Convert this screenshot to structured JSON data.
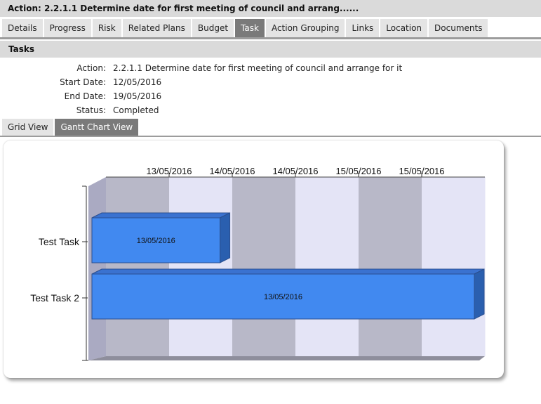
{
  "header": {
    "title": "Action: 2.2.1.1 Determine date for first meeting of council and arrang......"
  },
  "tabs": [
    {
      "label": "Details",
      "active": false
    },
    {
      "label": "Progress",
      "active": false
    },
    {
      "label": "Risk",
      "active": false
    },
    {
      "label": "Related Plans",
      "active": false
    },
    {
      "label": "Budget",
      "active": false
    },
    {
      "label": "Task",
      "active": true
    },
    {
      "label": "Action Grouping",
      "active": false
    },
    {
      "label": "Links",
      "active": false
    },
    {
      "label": "Location",
      "active": false
    },
    {
      "label": "Documents",
      "active": false
    }
  ],
  "section": {
    "title": "Tasks"
  },
  "info": {
    "action_label": "Action:",
    "action_value": "2.2.1.1 Determine date for first meeting of council and arrange for it",
    "start_label": "Start Date:",
    "start_value": "12/05/2016",
    "end_label": "End Date:",
    "end_value": "19/05/2016",
    "status_label": "Status:",
    "status_value": "Completed"
  },
  "view_tabs": [
    {
      "label": "Grid View",
      "active": false
    },
    {
      "label": "Gantt Chart View",
      "active": true
    }
  ],
  "colors": {
    "bar_front": "#4189f0",
    "bar_top": "#3a72d0",
    "bar_side": "#2a5faf",
    "band_dark": "#b8b8c8",
    "band_light": "#e4e4f6",
    "wall": "#aaaac2"
  },
  "chart_data": {
    "type": "gantt",
    "x_tick_labels": [
      "13/05/2016",
      "14/05/2016",
      "14/05/2016",
      "15/05/2016",
      "15/05/2016"
    ],
    "tasks": [
      {
        "name": "Test Task",
        "bar_label": "13/05/2016",
        "start_fraction": 0.0,
        "end_fraction": 0.335
      },
      {
        "name": "Test Task 2",
        "bar_label": "13/05/2016",
        "start_fraction": 0.0,
        "end_fraction": 1.0
      }
    ]
  }
}
